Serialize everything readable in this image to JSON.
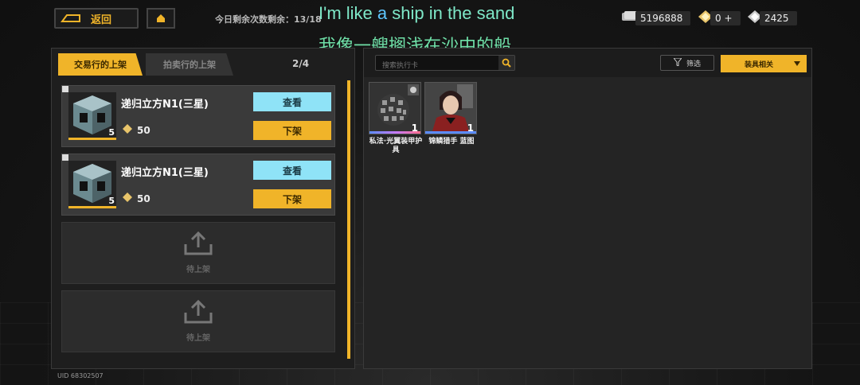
{
  "header": {
    "back_label": "返回",
    "daily_count": "今日剩余次数剩余：13/18"
  },
  "subtitles": {
    "en_part1": "I'm like ",
    "en_part2": "a",
    "en_part3": " ship in the sand",
    "zh": "我像一艘搁浅在沙中的船"
  },
  "currencies": [
    {
      "icon": "coins-icon",
      "value": "5196888"
    },
    {
      "icon": "gold-gem-icon",
      "value": "0"
    },
    {
      "icon": "crystal-icon",
      "value": "2425"
    }
  ],
  "left_panel": {
    "tabs": [
      {
        "label": "交易行的上架",
        "active": true
      },
      {
        "label": "拍卖行的上架",
        "active": false
      }
    ],
    "page_indicator": "2/4",
    "listings": [
      {
        "name": "递归立方N1(三星)",
        "qty": "5",
        "price": "50",
        "view_label": "查看",
        "delist_label": "下架"
      },
      {
        "name": "递归立方N1(三星)",
        "qty": "5",
        "price": "50",
        "view_label": "查看",
        "delist_label": "下架"
      }
    ],
    "empty_slots": [
      {
        "label": "待上架"
      },
      {
        "label": "待上架"
      }
    ]
  },
  "right_panel": {
    "search_placeholder": "搜索执行卡",
    "filter_label": "筛选",
    "sort_label": "装具相关",
    "cards": [
      {
        "name": "私法·光翼装甲护具",
        "qty": "1"
      },
      {
        "name": "锦鳞猎手 蓝图",
        "qty": "1"
      }
    ]
  },
  "footer": {
    "uid": "UID 68302507"
  },
  "colors": {
    "accent": "#f0b429",
    "view_button": "#8fe3f7"
  }
}
